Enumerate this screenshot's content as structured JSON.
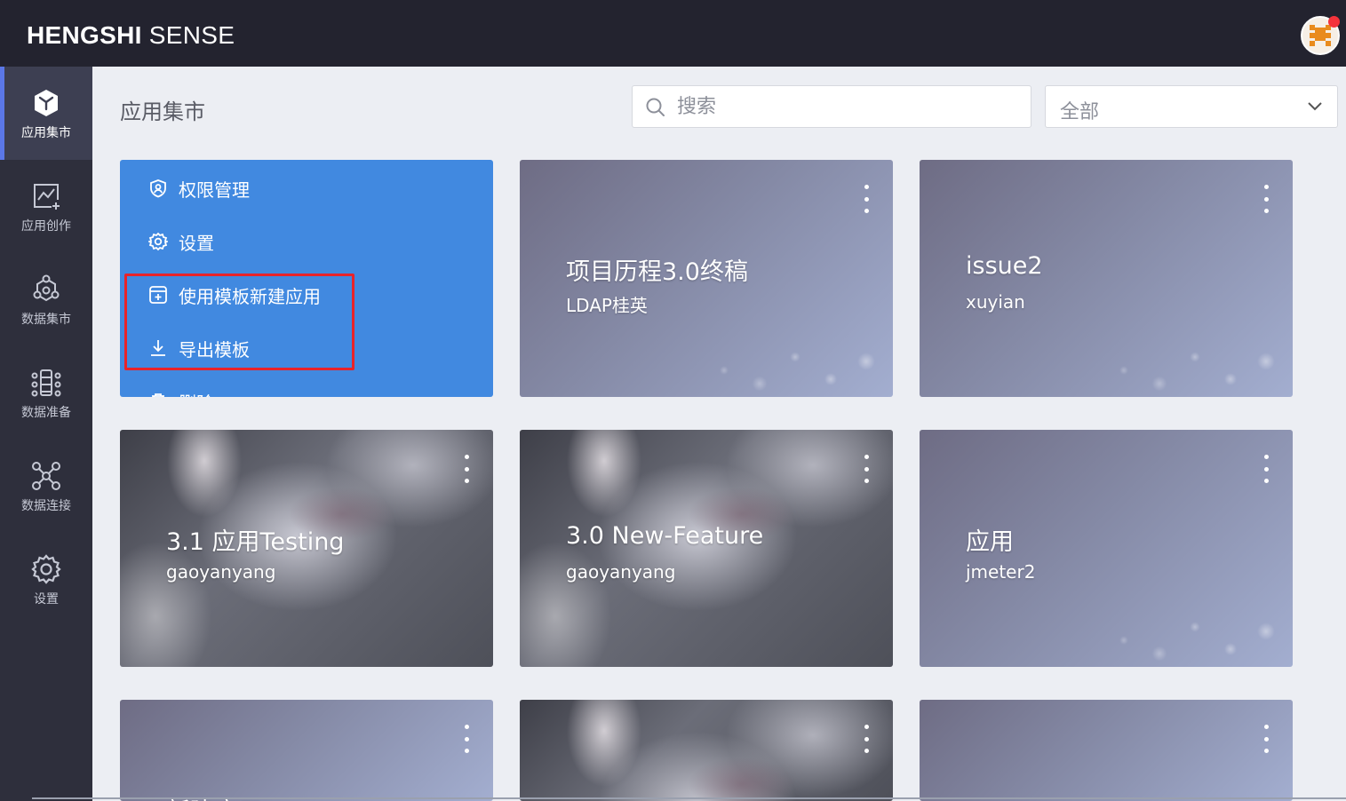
{
  "header": {
    "brand_bold": "HENGSHI",
    "brand_light": " SENSE",
    "avatar_icon": "pixel-avatar-icon"
  },
  "sidebar": {
    "items": [
      {
        "label": "应用集市",
        "icon": "cube-icon",
        "active": true
      },
      {
        "label": "应用创作",
        "icon": "chart-add-icon",
        "active": false
      },
      {
        "label": "数据集市",
        "icon": "hexagon-nodes-icon",
        "active": false
      },
      {
        "label": "数据准备",
        "icon": "data-prep-icon",
        "active": false
      },
      {
        "label": "数据连接",
        "icon": "network-icon",
        "active": false
      },
      {
        "label": "设置",
        "icon": "gear-icon",
        "active": false
      }
    ]
  },
  "main": {
    "title": "应用集市",
    "search_placeholder": "搜索",
    "filter_value": "全部"
  },
  "context_menu": {
    "items": [
      {
        "label": "权限管理",
        "icon": "shield-user-icon"
      },
      {
        "label": "设置",
        "icon": "gear-icon"
      },
      {
        "label": "使用模板新建应用",
        "icon": "template-add-icon"
      },
      {
        "label": "导出模板",
        "icon": "download-icon"
      },
      {
        "label": "删除",
        "icon": "delete-icon"
      }
    ]
  },
  "cards": [
    {
      "name": "项目历程3.0终稿",
      "owner": "LDAP桂英",
      "style": "gradient"
    },
    {
      "name": "issue2",
      "owner": "xuyian",
      "style": "gradient"
    },
    {
      "name": "3.1 应用Testing",
      "owner": "gaoyanyang",
      "style": "photo"
    },
    {
      "name": "3.0 New-Feature",
      "owner": "gaoyanyang",
      "style": "photo"
    },
    {
      "name": "应用",
      "owner": "jmeter2",
      "style": "gradient"
    },
    {
      "name": "新建应用",
      "owner": "",
      "style": "gradient"
    },
    {
      "name": "",
      "owner": "",
      "style": "photo"
    },
    {
      "name": "",
      "owner": "",
      "style": "gradient"
    }
  ],
  "colors": {
    "topbar": "#23232f",
    "sidebar": "#2e2f3c",
    "accent": "#4189e0",
    "highlight": "#e8232a"
  }
}
